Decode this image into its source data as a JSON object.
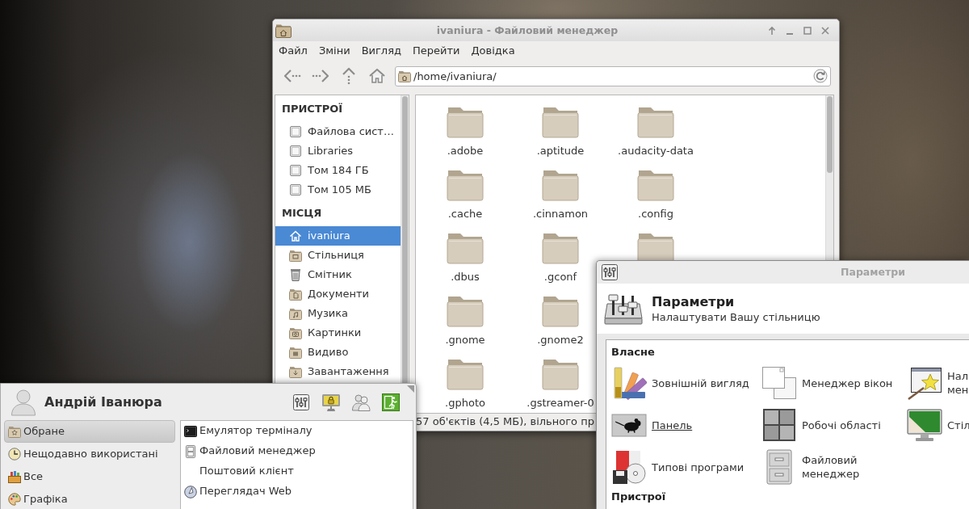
{
  "file_manager": {
    "title": "ivaniura - Файловий менеджер",
    "menu": [
      "Файл",
      "Зміни",
      "Вигляд",
      "Перейти",
      "Довідка"
    ],
    "location": "/home/ivaniura/",
    "sidebar": [
      {
        "heading": "ПРИСТРОЇ",
        "items": [
          {
            "label": "Файлова сист…",
            "kind": "drive",
            "selected": false
          },
          {
            "label": "Libraries",
            "kind": "drive",
            "selected": false
          },
          {
            "label": "Том 184 ГБ",
            "kind": "drive",
            "selected": false
          },
          {
            "label": "Том 105 МБ",
            "kind": "drive",
            "selected": false
          }
        ]
      },
      {
        "heading": "МІСЦЯ",
        "items": [
          {
            "label": "ivaniura",
            "kind": "home",
            "selected": true
          },
          {
            "label": "Стільниця",
            "kind": "desktop",
            "selected": false
          },
          {
            "label": "Смітник",
            "kind": "trash",
            "selected": false
          },
          {
            "label": "Документи",
            "kind": "documents",
            "selected": false
          },
          {
            "label": "Музика",
            "kind": "music",
            "selected": false
          },
          {
            "label": "Картинки",
            "kind": "pictures",
            "selected": false
          },
          {
            "label": "Видиво",
            "kind": "videos",
            "selected": false
          },
          {
            "label": "Завантаження",
            "kind": "downloads",
            "selected": false
          }
        ]
      }
    ],
    "file_rows": [
      [
        {
          "name": ".adobe",
          "kind": "folder"
        },
        {
          "name": ".aptitude",
          "kind": "folder"
        },
        {
          "name": ".audacity-data",
          "kind": "folder"
        }
      ],
      [
        {
          "name": ".cache",
          "kind": "folder"
        },
        {
          "name": ".cinnamon",
          "kind": "folder"
        },
        {
          "name": ".config",
          "kind": "folder"
        }
      ],
      [
        {
          "name": ".dbus",
          "kind": "folder"
        },
        {
          "name": ".gconf",
          "kind": "folder"
        },
        {
          "kind": "folder"
        }
      ],
      [
        {
          "name": ".gnome",
          "kind": "folder"
        },
        {
          "name": ".gnome2",
          "kind": "folder"
        }
      ],
      [
        {
          "name": ".gphoto",
          "kind": "folder"
        },
        {
          "name": ".gstreamer-0",
          "kind": "folder"
        }
      ]
    ],
    "status": "57 об'єктів (4,5 МБ), вільного пр"
  },
  "start_menu": {
    "user": "Андрій Іванюра",
    "categories": [
      {
        "label": "Обране",
        "kind": "favorites",
        "selected": true
      },
      {
        "label": "Нещодавно використані",
        "kind": "recent",
        "selected": false
      },
      {
        "label": "Все",
        "kind": "all",
        "selected": false
      },
      {
        "label": "Графіка",
        "kind": "graphics",
        "selected": false
      }
    ],
    "apps": [
      {
        "label": "Емулятор терміналу",
        "kind": "terminal"
      },
      {
        "label": "Файловий менеджер",
        "kind": "files"
      },
      {
        "label": "Поштовий клієнт"
      },
      {
        "label": "Переглядач Web",
        "kind": "web"
      }
    ]
  },
  "settings": {
    "window_title": "Параметри",
    "title": "Параметри",
    "subtitle": "Налаштувати Вашу стільницю",
    "sections": [
      {
        "heading": "Власне",
        "items": [
          {
            "label": "Зовнішній вигляд",
            "kind": "appearance",
            "hovered": false
          },
          {
            "label": "Менеджер вікон",
            "kind": "window_manager",
            "hovered": false
          },
          {
            "label": "Нал мен",
            "kind": "window_tweaks",
            "hovered": false
          },
          {
            "label": "Панель",
            "kind": "panel",
            "hovered": true
          },
          {
            "label": "Робочі області",
            "kind": "workspaces",
            "hovered": false
          },
          {
            "label": "Стіл",
            "kind": "desktop",
            "hovered": false
          },
          {
            "label": "Типові програми",
            "kind": "default_apps",
            "hovered": false
          },
          {
            "label": "Файловий менеджер",
            "kind": "file_manager",
            "hovered": false
          }
        ]
      },
      {
        "heading": "Пристрої"
      }
    ]
  }
}
